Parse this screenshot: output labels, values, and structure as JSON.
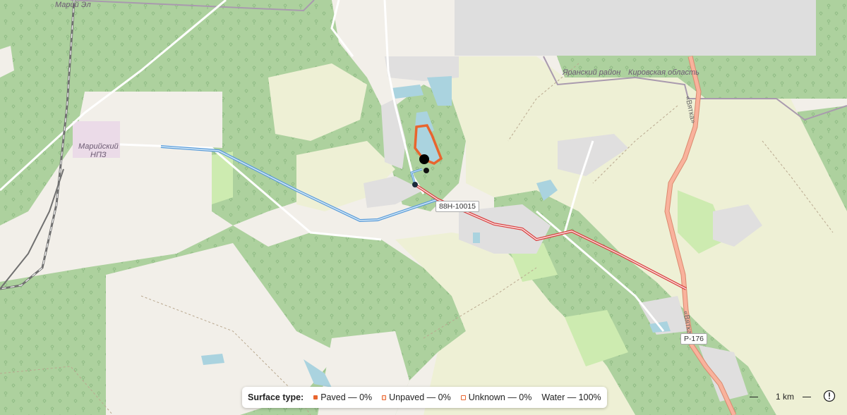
{
  "map": {
    "labels": {
      "mari_el": "Марий Эл",
      "refinery": "Марийский НПЗ",
      "refinery_line1": "Марийский",
      "refinery_line2": "НПЗ",
      "yaransky": "Яранский район",
      "kirov_oblast": "Кировская область",
      "vyatka_north": "«Вятка»",
      "vyatka_south": "«Вятка»"
    },
    "road_shields": {
      "regional": "88Н-10015",
      "federal": "Р-176"
    },
    "colors": {
      "forest": "#add19e",
      "farmland": "#eef0d5",
      "meadow": "#cdebb0",
      "water": "#aad3df",
      "route_water": "#7fb6e6",
      "route_red": "#e05a5a",
      "highlight_orange": "#e8652e",
      "trunk_road": "#f9b29c"
    }
  },
  "legend": {
    "title": "Surface type:",
    "items": [
      {
        "label": "Paved — 0%",
        "swatch": "paved"
      },
      {
        "label": "Unpaved — 0%",
        "swatch": "unpaved"
      },
      {
        "label": "Unknown — 0%",
        "swatch": "unknown"
      },
      {
        "label": "Water — 100%",
        "swatch": "none"
      }
    ]
  },
  "scale": {
    "label": "1 km"
  },
  "controls": {
    "info_icon": "info-icon"
  }
}
